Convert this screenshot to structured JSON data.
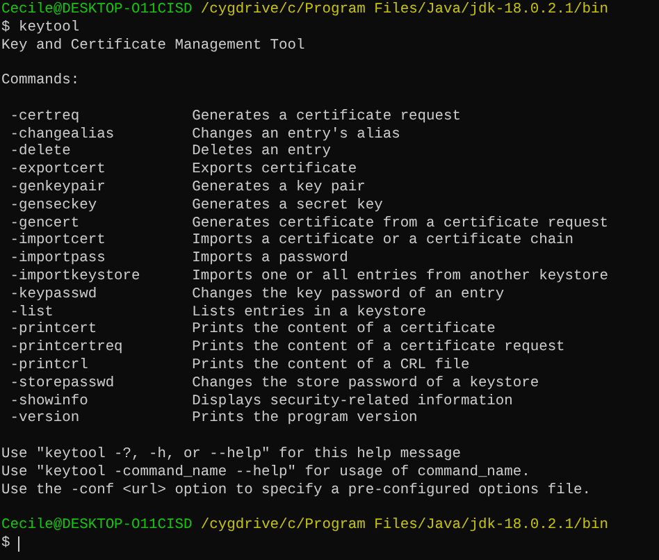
{
  "session": [
    {
      "kind": "prompt",
      "user": "Cecile@DESKTOP-O11CISD",
      "path": "/cygdrive/c/Program Files/Java/jdk-18.0.2.1/bin"
    },
    {
      "kind": "text",
      "text": "$ keytool"
    },
    {
      "kind": "text",
      "text": "Key and Certificate Management Tool"
    },
    {
      "kind": "blank"
    },
    {
      "kind": "text",
      "text": "Commands:"
    },
    {
      "kind": "blank"
    },
    {
      "kind": "commands",
      "items": [
        {
          "command": "-certreq",
          "description": "Generates a certificate request"
        },
        {
          "command": "-changealias",
          "description": "Changes an entry's alias"
        },
        {
          "command": "-delete",
          "description": "Deletes an entry"
        },
        {
          "command": "-exportcert",
          "description": "Exports certificate"
        },
        {
          "command": "-genkeypair",
          "description": "Generates a key pair"
        },
        {
          "command": "-genseckey",
          "description": "Generates a secret key"
        },
        {
          "command": "-gencert",
          "description": "Generates certificate from a certificate request"
        },
        {
          "command": "-importcert",
          "description": "Imports a certificate or a certificate chain"
        },
        {
          "command": "-importpass",
          "description": "Imports a password"
        },
        {
          "command": "-importkeystore",
          "description": "Imports one or all entries from another keystore"
        },
        {
          "command": "-keypasswd",
          "description": "Changes the key password of an entry"
        },
        {
          "command": "-list",
          "description": "Lists entries in a keystore"
        },
        {
          "command": "-printcert",
          "description": "Prints the content of a certificate"
        },
        {
          "command": "-printcertreq",
          "description": "Prints the content of a certificate request"
        },
        {
          "command": "-printcrl",
          "description": "Prints the content of a CRL file"
        },
        {
          "command": "-storepasswd",
          "description": "Changes the store password of a keystore"
        },
        {
          "command": "-showinfo",
          "description": "Displays security-related information"
        },
        {
          "command": "-version",
          "description": "Prints the program version"
        }
      ]
    },
    {
      "kind": "blank"
    },
    {
      "kind": "text",
      "text": "Use \"keytool -?, -h, or --help\" for this help message"
    },
    {
      "kind": "text",
      "text": "Use \"keytool -command_name --help\" for usage of command_name."
    },
    {
      "kind": "text",
      "text": "Use the -conf <url> option to specify a pre-configured options file."
    },
    {
      "kind": "blank"
    },
    {
      "kind": "prompt",
      "user": "Cecile@DESKTOP-O11CISD",
      "path": "/cygdrive/c/Program Files/Java/jdk-18.0.2.1/bin"
    },
    {
      "kind": "input",
      "symbol": "$"
    }
  ]
}
